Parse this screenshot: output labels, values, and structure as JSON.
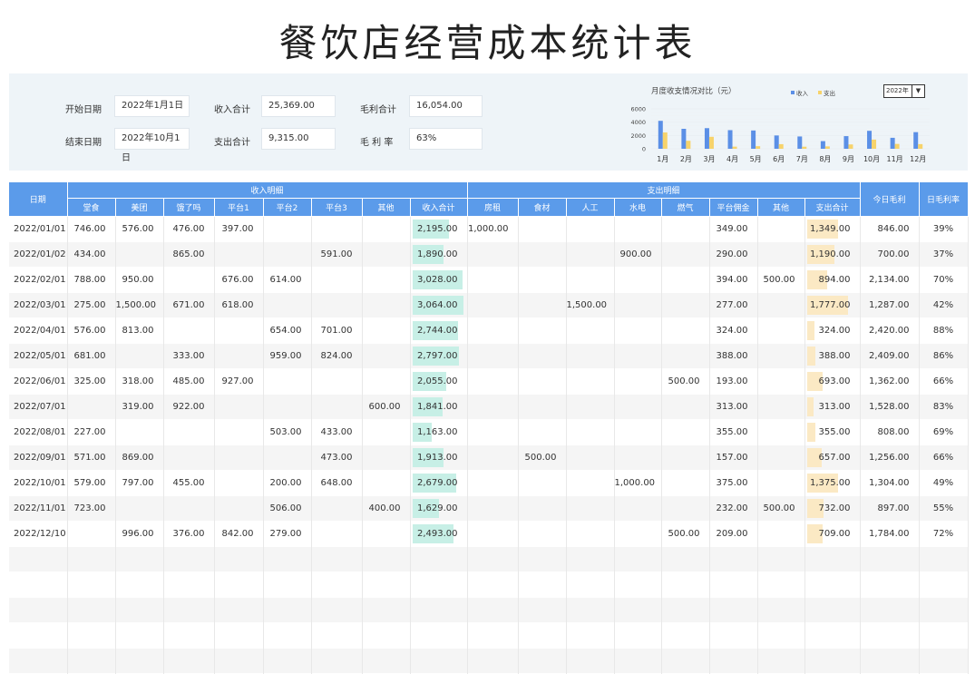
{
  "title": "餐饮店经营成本统计表",
  "summary": {
    "start_label": "开始日期",
    "start_value": "2022年1月1日",
    "end_label": "结束日期",
    "end_value": "2022年10月1日",
    "income_label": "收入合计",
    "income_value": "25,369.00",
    "expense_label": "支出合计",
    "expense_value": "9,315.00",
    "profit_label": "毛利合计",
    "profit_value": "16,054.00",
    "rate_label": "毛 利 率",
    "rate_value": "63%"
  },
  "year_select": {
    "value": "2022年",
    "arrow_icon": "dropdown-arrow-icon"
  },
  "chart_data": {
    "type": "bar",
    "title": "月度收支情况对比（元）",
    "categories": [
      "1月",
      "2月",
      "3月",
      "4月",
      "5月",
      "6月",
      "7月",
      "8月",
      "9月",
      "10月",
      "11月",
      "12月"
    ],
    "series": [
      {
        "name": "收入",
        "color": "#5b8fe6",
        "values": [
          4200,
          3000,
          3100,
          2800,
          2750,
          2000,
          1850,
          1150,
          1900,
          2700,
          1650,
          2500
        ]
      },
      {
        "name": "支出",
        "color": "#f7d36b",
        "values": [
          2450,
          1200,
          1800,
          320,
          390,
          690,
          310,
          360,
          650,
          1380,
          730,
          700
        ]
      }
    ],
    "ylim": [
      0,
      6000
    ],
    "yticks": [
      "6000",
      "4000",
      "2000",
      "0"
    ],
    "legend": "top-right"
  },
  "table": {
    "headers": {
      "date": "日期",
      "income_group": "收入明细",
      "expense_group": "支出明细",
      "daily_profit": "今日毛利",
      "daily_rate": "日毛利率",
      "income_cols": [
        "堂食",
        "美团",
        "饿了吗",
        "平台1",
        "平台2",
        "平台3",
        "其他",
        "收入合计"
      ],
      "expense_cols": [
        "房租",
        "食材",
        "人工",
        "水电",
        "燃气",
        "平台佣金",
        "其他",
        "支出合计"
      ]
    },
    "income_max": 3064,
    "expense_max": 1777,
    "rows": [
      {
        "date": "2022/01/01",
        "inc": [
          "746.00",
          "576.00",
          "476.00",
          "397.00",
          "",
          "",
          "",
          "2,195.00"
        ],
        "inc_total": 2195,
        "exp": [
          "1,000.00",
          "",
          "",
          "",
          "",
          "349.00",
          "",
          "1,349.00"
        ],
        "exp_total": 1349,
        "profit": "846.00",
        "rate": "39%"
      },
      {
        "date": "2022/01/02",
        "inc": [
          "434.00",
          "",
          "865.00",
          "",
          "",
          "591.00",
          "",
          "1,890.00"
        ],
        "inc_total": 1890,
        "exp": [
          "",
          "",
          "",
          "900.00",
          "",
          "290.00",
          "",
          "1,190.00"
        ],
        "exp_total": 1190,
        "profit": "700.00",
        "rate": "37%"
      },
      {
        "date": "2022/02/01",
        "inc": [
          "788.00",
          "950.00",
          "",
          "676.00",
          "614.00",
          "",
          "",
          "3,028.00"
        ],
        "inc_total": 3028,
        "exp": [
          "",
          "",
          "",
          "",
          "",
          "394.00",
          "500.00",
          "894.00"
        ],
        "exp_total": 894,
        "profit": "2,134.00",
        "rate": "70%"
      },
      {
        "date": "2022/03/01",
        "inc": [
          "275.00",
          "1,500.00",
          "671.00",
          "618.00",
          "",
          "",
          "",
          "3,064.00"
        ],
        "inc_total": 3064,
        "exp": [
          "",
          "",
          "1,500.00",
          "",
          "",
          "277.00",
          "",
          "1,777.00"
        ],
        "exp_total": 1777,
        "profit": "1,287.00",
        "rate": "42%"
      },
      {
        "date": "2022/04/01",
        "inc": [
          "576.00",
          "813.00",
          "",
          "",
          "654.00",
          "701.00",
          "",
          "2,744.00"
        ],
        "inc_total": 2744,
        "exp": [
          "",
          "",
          "",
          "",
          "",
          "324.00",
          "",
          "324.00"
        ],
        "exp_total": 324,
        "profit": "2,420.00",
        "rate": "88%"
      },
      {
        "date": "2022/05/01",
        "inc": [
          "681.00",
          "",
          "333.00",
          "",
          "959.00",
          "824.00",
          "",
          "2,797.00"
        ],
        "inc_total": 2797,
        "exp": [
          "",
          "",
          "",
          "",
          "",
          "388.00",
          "",
          "388.00"
        ],
        "exp_total": 388,
        "profit": "2,409.00",
        "rate": "86%"
      },
      {
        "date": "2022/06/01",
        "inc": [
          "325.00",
          "318.00",
          "485.00",
          "927.00",
          "",
          "",
          "",
          "2,055.00"
        ],
        "inc_total": 2055,
        "exp": [
          "",
          "",
          "",
          "",
          "500.00",
          "193.00",
          "",
          "693.00"
        ],
        "exp_total": 693,
        "profit": "1,362.00",
        "rate": "66%"
      },
      {
        "date": "2022/07/01",
        "inc": [
          "",
          "319.00",
          "922.00",
          "",
          "",
          "",
          "600.00",
          "1,841.00"
        ],
        "inc_total": 1841,
        "exp": [
          "",
          "",
          "",
          "",
          "",
          "313.00",
          "",
          "313.00"
        ],
        "exp_total": 313,
        "profit": "1,528.00",
        "rate": "83%"
      },
      {
        "date": "2022/08/01",
        "inc": [
          "227.00",
          "",
          "",
          "",
          "503.00",
          "433.00",
          "",
          "1,163.00"
        ],
        "inc_total": 1163,
        "exp": [
          "",
          "",
          "",
          "",
          "",
          "355.00",
          "",
          "355.00"
        ],
        "exp_total": 355,
        "profit": "808.00",
        "rate": "69%"
      },
      {
        "date": "2022/09/01",
        "inc": [
          "571.00",
          "869.00",
          "",
          "",
          "",
          "473.00",
          "",
          "1,913.00"
        ],
        "inc_total": 1913,
        "exp": [
          "",
          "500.00",
          "",
          "",
          "",
          "157.00",
          "",
          "657.00"
        ],
        "exp_total": 657,
        "profit": "1,256.00",
        "rate": "66%"
      },
      {
        "date": "2022/10/01",
        "inc": [
          "579.00",
          "797.00",
          "455.00",
          "",
          "200.00",
          "648.00",
          "",
          "2,679.00"
        ],
        "inc_total": 2679,
        "exp": [
          "",
          "",
          "",
          "1,000.00",
          "",
          "375.00",
          "",
          "1,375.00"
        ],
        "exp_total": 1375,
        "profit": "1,304.00",
        "rate": "49%"
      },
      {
        "date": "2022/11/01",
        "inc": [
          "723.00",
          "",
          "",
          "",
          "506.00",
          "",
          "400.00",
          "1,629.00"
        ],
        "inc_total": 1629,
        "exp": [
          "",
          "",
          "",
          "",
          "",
          "232.00",
          "500.00",
          "732.00"
        ],
        "exp_total": 732,
        "profit": "897.00",
        "rate": "55%"
      },
      {
        "date": "2022/12/10",
        "inc": [
          "",
          "996.00",
          "376.00",
          "842.00",
          "279.00",
          "",
          "",
          "2,493.00"
        ],
        "inc_total": 2493,
        "exp": [
          "",
          "",
          "",
          "",
          "500.00",
          "209.00",
          "",
          "709.00"
        ],
        "exp_total": 709,
        "profit": "1,784.00",
        "rate": "72%"
      }
    ],
    "empty_rows": 5
  }
}
